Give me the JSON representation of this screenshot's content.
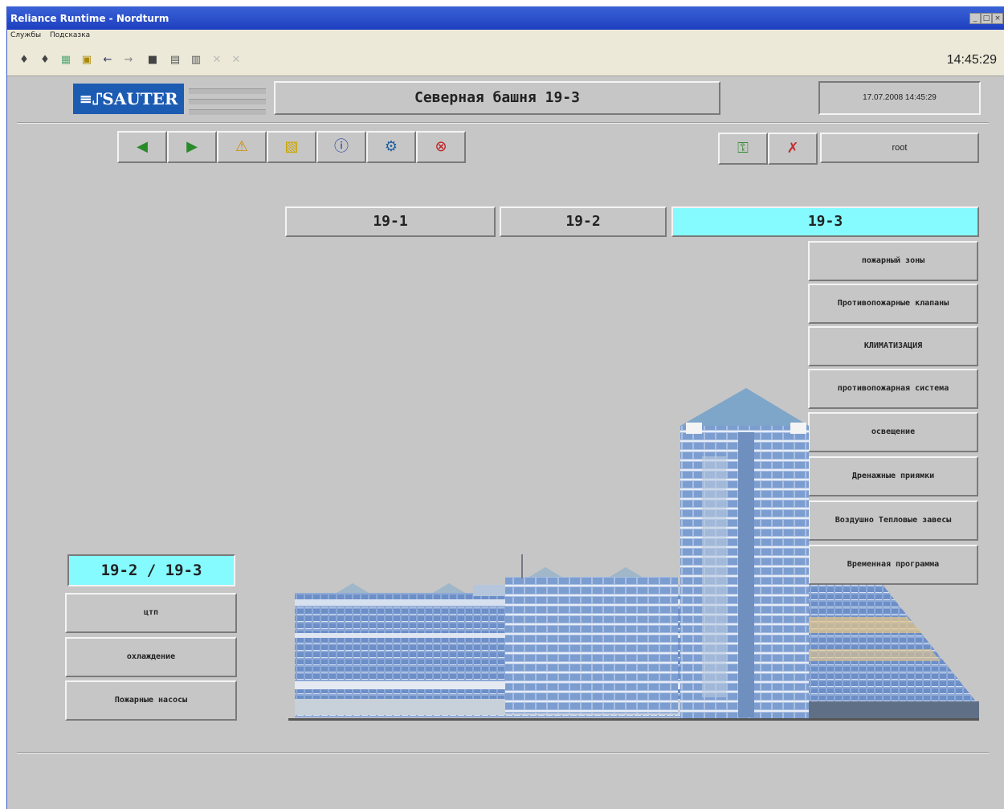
{
  "window": {
    "title": "Reliance Runtime - Nordturm"
  },
  "menu": [
    "Службы",
    "Подсказка"
  ],
  "toolbar": {
    "clock": "14:45:29"
  },
  "header": {
    "logo": "≡⑀SAUTER",
    "title": "Северная башня 19-3",
    "datetime": "17.07.2008 14:45:29",
    "user": "root"
  },
  "tabs": [
    {
      "label": "19-1",
      "active": false
    },
    {
      "label": "19-2",
      "active": false
    },
    {
      "label": "19-3",
      "active": true
    }
  ],
  "right_menu": [
    "пожарный зоны",
    "Противопожарные клапаны",
    "КЛИМАТИЗАЦИЯ",
    "противопожарная система",
    "освещение",
    "Дренажные приямки",
    "Воздушно Тепловые завесы",
    "Временная программа"
  ],
  "left_panel": {
    "heading": "19-2 / 19-3",
    "items": [
      "цтп",
      "охлаждение",
      "Пожарные насосы"
    ]
  },
  "colors": {
    "active_tab": "#85faff",
    "background": "#c6c6c6",
    "titlebar": "#1e3fc0",
    "logo": "#1c5bb2"
  }
}
